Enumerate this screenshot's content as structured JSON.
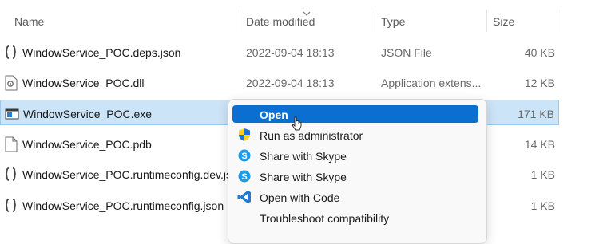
{
  "columns": {
    "name": "Name",
    "date_modified": "Date modified",
    "type": "Type",
    "size": "Size"
  },
  "files": [
    {
      "name": "WindowService_POC.deps.json",
      "date": "2022-09-04 18:13",
      "type": "JSON File",
      "size": "40 KB",
      "icon": "json-file-icon"
    },
    {
      "name": "WindowService_POC.dll",
      "date": "2022-09-04 18:13",
      "type": "Application extens...",
      "size": "12 KB",
      "icon": "dll-file-icon"
    },
    {
      "name": "WindowService_POC.exe",
      "date": "",
      "type": "",
      "size": "171 KB",
      "icon": "exe-file-icon",
      "selected": true
    },
    {
      "name": "WindowService_POC.pdb",
      "date": "",
      "type": "",
      "size": "14 KB",
      "icon": "file-icon"
    },
    {
      "name": "WindowService_POC.runtimeconfig.dev.js...",
      "date": "",
      "type": "",
      "size": "1 KB",
      "icon": "json-file-icon"
    },
    {
      "name": "WindowService_POC.runtimeconfig.json",
      "date": "",
      "type": "",
      "size": "1 KB",
      "icon": "json-file-icon"
    }
  ],
  "context_menu": {
    "items": [
      {
        "label": "Open",
        "icon": "",
        "highlighted": true
      },
      {
        "label": "Run as administrator",
        "icon": "uac-shield-icon"
      },
      {
        "label": "Share with Skype",
        "icon": "skype-icon"
      },
      {
        "label": "Share with Skype",
        "icon": "skype-icon"
      },
      {
        "label": "Open with Code",
        "icon": "vscode-icon"
      },
      {
        "label": "Troubleshoot compatibility",
        "icon": ""
      }
    ]
  },
  "colors": {
    "selection_bg": "#cce4f7",
    "menu_highlight": "#0a6fd0",
    "skype": "#1e9be9",
    "vscode": "#1f7ad0"
  }
}
